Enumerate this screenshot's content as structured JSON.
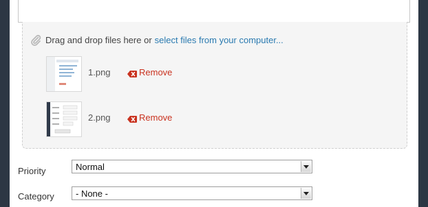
{
  "upload": {
    "drop_prefix": "Drag and drop files here or",
    "select_link": "select files from your computer...",
    "icon": "paperclip-icon"
  },
  "files": [
    {
      "name": "1.png",
      "remove_label": "Remove",
      "thumbnail_icon": "screenshot-thumbnail"
    },
    {
      "name": "2.png",
      "remove_label": "Remove",
      "thumbnail_icon": "screenshot-thumbnail"
    }
  ],
  "fields": {
    "priority": {
      "label": "Priority",
      "value": "Normal"
    },
    "category": {
      "label": "Category",
      "value": "- None -"
    }
  },
  "colors": {
    "link": "#2a7ab0",
    "remove": "#c9321f",
    "frame": "#2d3744"
  }
}
